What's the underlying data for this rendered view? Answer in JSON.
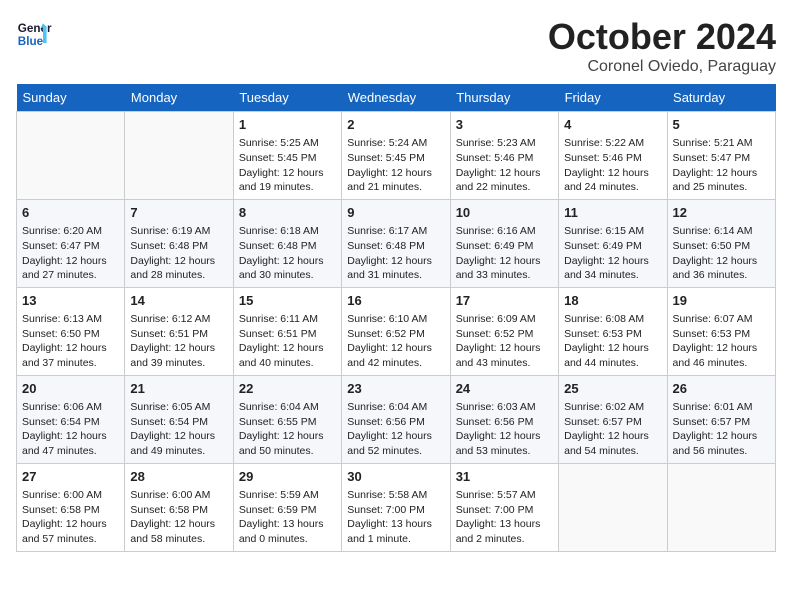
{
  "header": {
    "logo_line1": "General",
    "logo_line2": "Blue",
    "month": "October 2024",
    "location": "Coronel Oviedo, Paraguay"
  },
  "days_of_week": [
    "Sunday",
    "Monday",
    "Tuesday",
    "Wednesday",
    "Thursday",
    "Friday",
    "Saturday"
  ],
  "weeks": [
    [
      {
        "day": "",
        "empty": true
      },
      {
        "day": "",
        "empty": true
      },
      {
        "day": "1",
        "sunrise": "5:25 AM",
        "sunset": "5:45 PM",
        "daylight": "12 hours and 19 minutes."
      },
      {
        "day": "2",
        "sunrise": "5:24 AM",
        "sunset": "5:45 PM",
        "daylight": "12 hours and 21 minutes."
      },
      {
        "day": "3",
        "sunrise": "5:23 AM",
        "sunset": "5:46 PM",
        "daylight": "12 hours and 22 minutes."
      },
      {
        "day": "4",
        "sunrise": "5:22 AM",
        "sunset": "5:46 PM",
        "daylight": "12 hours and 24 minutes."
      },
      {
        "day": "5",
        "sunrise": "5:21 AM",
        "sunset": "5:47 PM",
        "daylight": "12 hours and 25 minutes."
      }
    ],
    [
      {
        "day": "6",
        "sunrise": "6:20 AM",
        "sunset": "6:47 PM",
        "daylight": "12 hours and 27 minutes."
      },
      {
        "day": "7",
        "sunrise": "6:19 AM",
        "sunset": "6:48 PM",
        "daylight": "12 hours and 28 minutes."
      },
      {
        "day": "8",
        "sunrise": "6:18 AM",
        "sunset": "6:48 PM",
        "daylight": "12 hours and 30 minutes."
      },
      {
        "day": "9",
        "sunrise": "6:17 AM",
        "sunset": "6:48 PM",
        "daylight": "12 hours and 31 minutes."
      },
      {
        "day": "10",
        "sunrise": "6:16 AM",
        "sunset": "6:49 PM",
        "daylight": "12 hours and 33 minutes."
      },
      {
        "day": "11",
        "sunrise": "6:15 AM",
        "sunset": "6:49 PM",
        "daylight": "12 hours and 34 minutes."
      },
      {
        "day": "12",
        "sunrise": "6:14 AM",
        "sunset": "6:50 PM",
        "daylight": "12 hours and 36 minutes."
      }
    ],
    [
      {
        "day": "13",
        "sunrise": "6:13 AM",
        "sunset": "6:50 PM",
        "daylight": "12 hours and 37 minutes."
      },
      {
        "day": "14",
        "sunrise": "6:12 AM",
        "sunset": "6:51 PM",
        "daylight": "12 hours and 39 minutes."
      },
      {
        "day": "15",
        "sunrise": "6:11 AM",
        "sunset": "6:51 PM",
        "daylight": "12 hours and 40 minutes."
      },
      {
        "day": "16",
        "sunrise": "6:10 AM",
        "sunset": "6:52 PM",
        "daylight": "12 hours and 42 minutes."
      },
      {
        "day": "17",
        "sunrise": "6:09 AM",
        "sunset": "6:52 PM",
        "daylight": "12 hours and 43 minutes."
      },
      {
        "day": "18",
        "sunrise": "6:08 AM",
        "sunset": "6:53 PM",
        "daylight": "12 hours and 44 minutes."
      },
      {
        "day": "19",
        "sunrise": "6:07 AM",
        "sunset": "6:53 PM",
        "daylight": "12 hours and 46 minutes."
      }
    ],
    [
      {
        "day": "20",
        "sunrise": "6:06 AM",
        "sunset": "6:54 PM",
        "daylight": "12 hours and 47 minutes."
      },
      {
        "day": "21",
        "sunrise": "6:05 AM",
        "sunset": "6:54 PM",
        "daylight": "12 hours and 49 minutes."
      },
      {
        "day": "22",
        "sunrise": "6:04 AM",
        "sunset": "6:55 PM",
        "daylight": "12 hours and 50 minutes."
      },
      {
        "day": "23",
        "sunrise": "6:04 AM",
        "sunset": "6:56 PM",
        "daylight": "12 hours and 52 minutes."
      },
      {
        "day": "24",
        "sunrise": "6:03 AM",
        "sunset": "6:56 PM",
        "daylight": "12 hours and 53 minutes."
      },
      {
        "day": "25",
        "sunrise": "6:02 AM",
        "sunset": "6:57 PM",
        "daylight": "12 hours and 54 minutes."
      },
      {
        "day": "26",
        "sunrise": "6:01 AM",
        "sunset": "6:57 PM",
        "daylight": "12 hours and 56 minutes."
      }
    ],
    [
      {
        "day": "27",
        "sunrise": "6:00 AM",
        "sunset": "6:58 PM",
        "daylight": "12 hours and 57 minutes."
      },
      {
        "day": "28",
        "sunrise": "6:00 AM",
        "sunset": "6:58 PM",
        "daylight": "12 hours and 58 minutes."
      },
      {
        "day": "29",
        "sunrise": "5:59 AM",
        "sunset": "6:59 PM",
        "daylight": "13 hours and 0 minutes."
      },
      {
        "day": "30",
        "sunrise": "5:58 AM",
        "sunset": "7:00 PM",
        "daylight": "13 hours and 1 minute."
      },
      {
        "day": "31",
        "sunrise": "5:57 AM",
        "sunset": "7:00 PM",
        "daylight": "13 hours and 2 minutes."
      },
      {
        "day": "",
        "empty": true
      },
      {
        "day": "",
        "empty": true
      }
    ]
  ],
  "labels": {
    "sunrise": "Sunrise:",
    "sunset": "Sunset:",
    "daylight": "Daylight:"
  }
}
